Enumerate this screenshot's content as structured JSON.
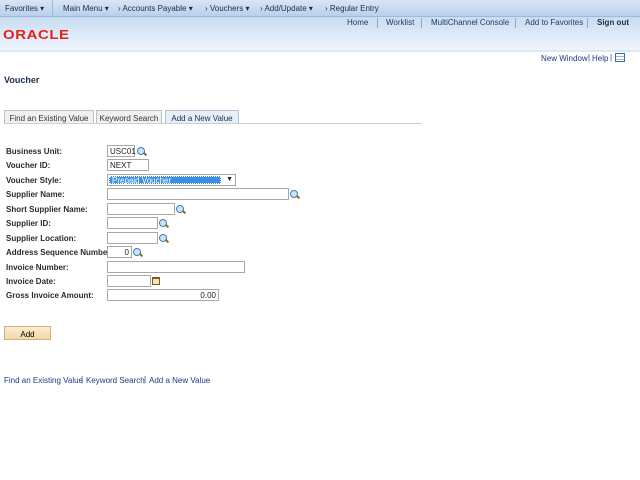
{
  "breadcrumb": {
    "favorites": "Favorites ▾",
    "main_menu": "Main Menu ▾",
    "items": [
      "› Accounts Payable ▾",
      "› Vouchers ▾",
      "› Add/Update ▾",
      "› Regular Entry"
    ]
  },
  "header": {
    "links": [
      "Home",
      "Worklist",
      "MultiChannel Console",
      "Add to Favorites"
    ],
    "sign_out": "Sign out",
    "logo": "ORACLE"
  },
  "util": {
    "new_window": "New Window",
    "help": "Help",
    "sep": "|"
  },
  "page": {
    "title": "Voucher"
  },
  "tabs": [
    "Find an Existing Value",
    "Keyword Search",
    "Add a New Value"
  ],
  "form": {
    "business_unit": {
      "label": "Business Unit:",
      "value": "USC01"
    },
    "voucher_id": {
      "label": "Voucher ID:",
      "value": "NEXT"
    },
    "voucher_style": {
      "label": "Voucher Style:",
      "value": "Prepaid Voucher"
    },
    "supplier_name": {
      "label": "Supplier Name:",
      "value": ""
    },
    "short_supplier_name": {
      "label": "Short Supplier Name:",
      "value": ""
    },
    "supplier_id": {
      "label": "Supplier ID:",
      "value": ""
    },
    "supplier_location": {
      "label": "Supplier Location:",
      "value": ""
    },
    "address_seq": {
      "label": "Address Sequence Number:",
      "value": "0"
    },
    "invoice_number": {
      "label": "Invoice Number:",
      "value": ""
    },
    "invoice_date": {
      "label": "Invoice Date:",
      "value": ""
    },
    "gross_amount": {
      "label": "Gross Invoice Amount:",
      "value": "0.00"
    }
  },
  "add_button": "Add",
  "footer_links": [
    "Find an Existing Value",
    "Keyword Search",
    "Add a New Value"
  ],
  "colors": {
    "logo": "#e2231a",
    "select_highlight": "#3d8ee8",
    "button": "#f7e0b5"
  }
}
